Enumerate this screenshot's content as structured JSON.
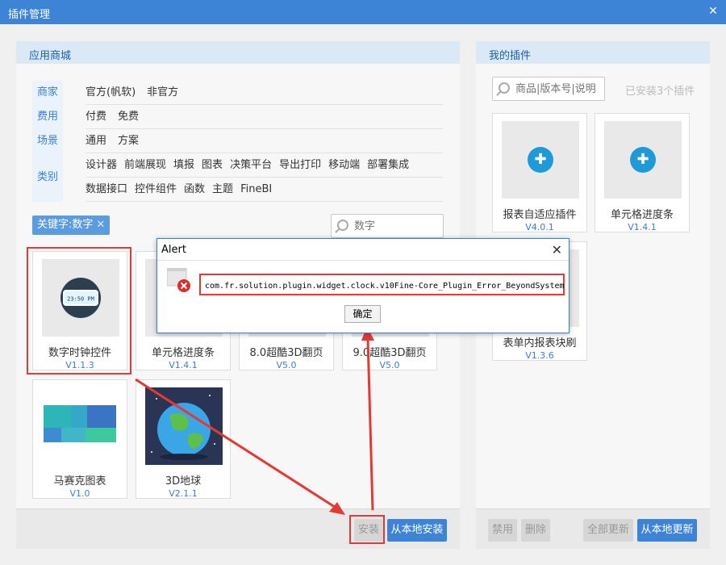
{
  "window": {
    "title": "插件管理"
  },
  "store": {
    "title": "应用商城",
    "filter_labels": [
      "商家",
      "费用",
      "场景",
      "类别"
    ],
    "rows": [
      [
        "官方(帆软)",
        "非官方"
      ],
      [
        "付费",
        "免费"
      ],
      [
        "通用",
        "方案"
      ],
      [
        "设计器",
        "前端展现",
        "填报",
        "图表",
        "决策平台",
        "导出打印",
        "移动端",
        "部署集成"
      ],
      [
        "数据接口",
        "控件组件",
        "函数",
        "主题",
        "FineBI"
      ]
    ],
    "keyword_tag": "关键字:数字",
    "search_placeholder": "数字",
    "plugins": [
      {
        "name": "数字时钟控件",
        "version": "V1.1.3",
        "clock_text": "23:50 PM"
      },
      {
        "name": "单元格进度条",
        "version": "V1.4.1"
      },
      {
        "name": "8.0超酷3D翻页",
        "version": "V5.0"
      },
      {
        "name": "9.0超酷3D翻页",
        "version": "V5.0"
      },
      {
        "name": "马赛克图表",
        "version": "V1.0"
      },
      {
        "name": "3D地球",
        "version": "V2.1.1"
      }
    ],
    "install_button": "安装",
    "install_local_button": "从本地安装"
  },
  "mine": {
    "title": "我的插件",
    "search_placeholder": "商品|版本号|说明",
    "installed_count": "已安装3个插件",
    "plugins": [
      {
        "name": "报表自适应插件",
        "version": "V4.0.1"
      },
      {
        "name": "单元格进度条",
        "version": "V1.4.1"
      },
      {
        "name": "表单内报表块刷",
        "version": "V1.3.6"
      }
    ],
    "disable_button": "禁用",
    "delete_button": "删除",
    "update_all_button": "全部更新",
    "update_local_button": "从本地更新"
  },
  "alert": {
    "title": "Alert",
    "message": "com.fr.solution.plugin.widget.clock.v10Fine-Core_Plugin_Error_BeyondSystem",
    "ok_button": "确定"
  },
  "colors": {
    "accent": "#3e84d6",
    "annotation": "#e53935"
  }
}
